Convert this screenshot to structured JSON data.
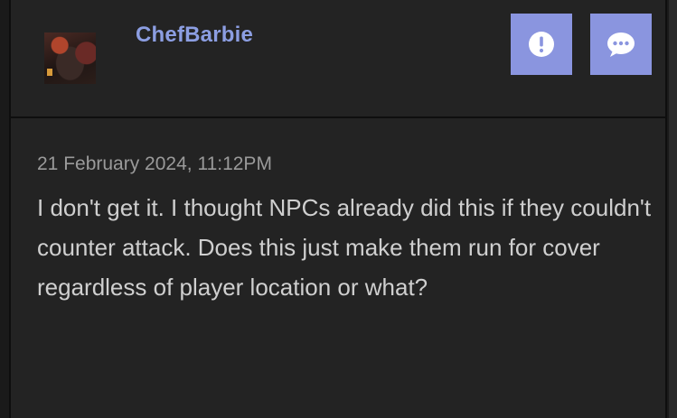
{
  "post": {
    "username": "ChefBarbie",
    "date": "21 February 2024, 11:12PM",
    "body": "I don't get it. I thought NPCs already did this if they couldn't counter attack. Does this just make them run for cover regardless of player location or what?"
  },
  "actions": {
    "report_icon": "exclamation-circle-icon",
    "reply_icon": "speech-bubble-icon"
  },
  "colors": {
    "accent": "#8a95df",
    "username": "#8c9ee2",
    "background": "#232323",
    "text": "#cfcfcf",
    "muted": "#9a9a9a"
  }
}
